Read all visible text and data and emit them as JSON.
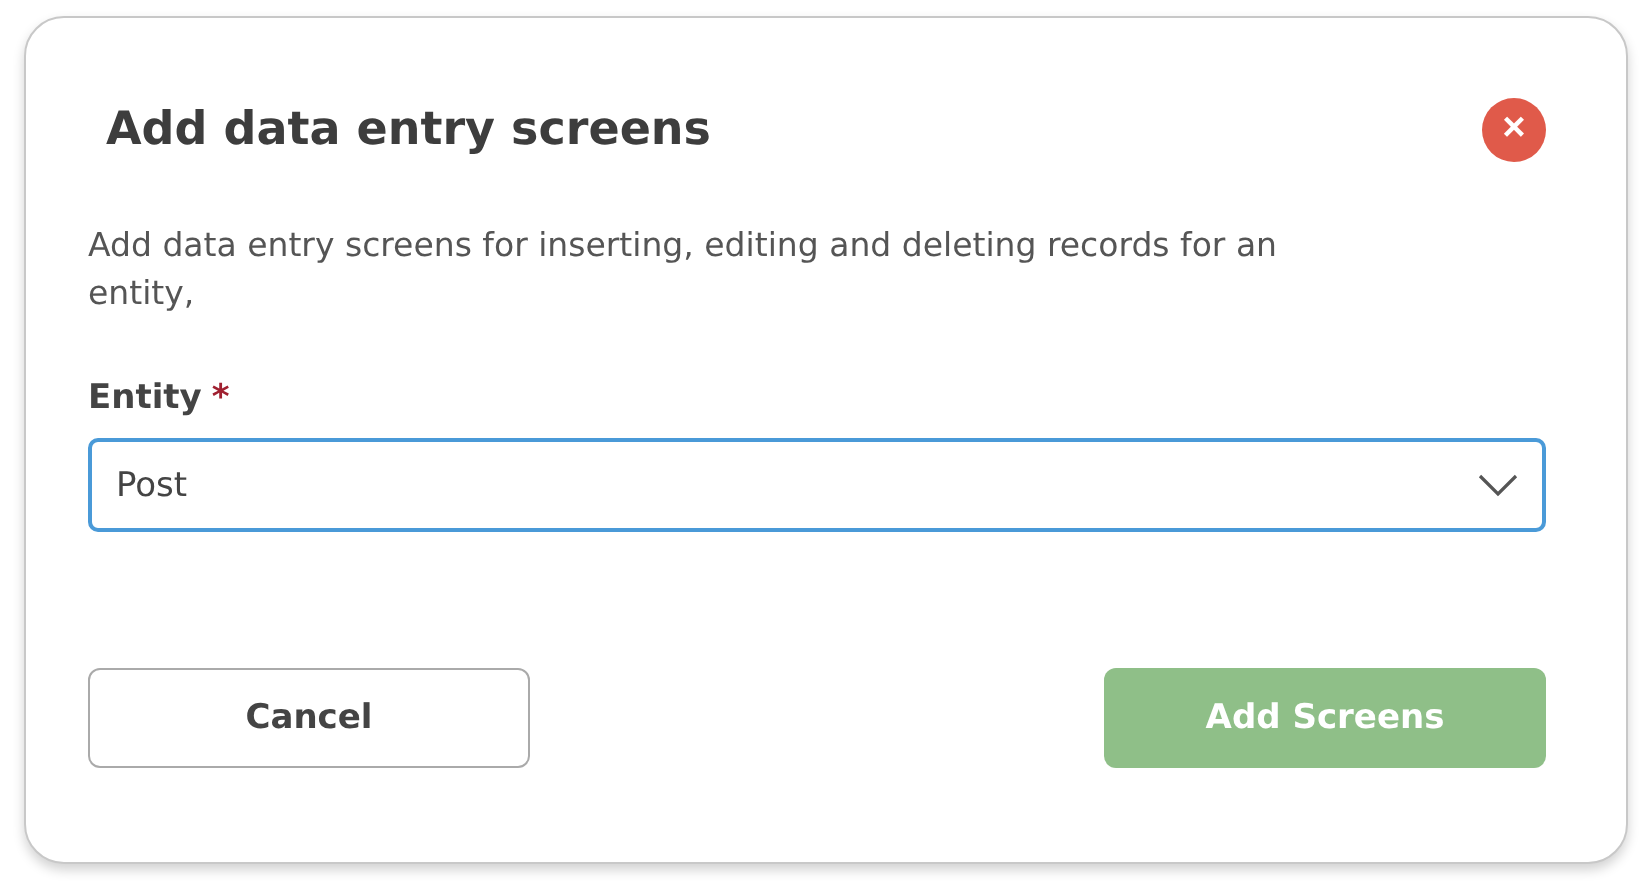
{
  "dialog": {
    "title": "Add data entry screens",
    "close": "×",
    "description": "Add data entry screens for inserting, editing and deleting records for an entity,",
    "field": {
      "label": "Entity",
      "required_mark": "*",
      "value": "Post",
      "focused": true
    },
    "buttons": [
      {
        "kind": "secondary",
        "label": "Cancel",
        "disabled": false
      },
      {
        "kind": "primary",
        "label": "Add Screens",
        "disabled": true
      }
    ]
  }
}
